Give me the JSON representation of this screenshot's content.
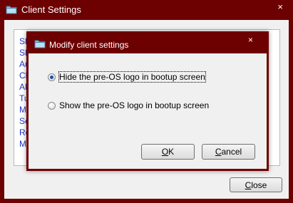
{
  "outer_window": {
    "title": "Client Settings",
    "close_glyph": "×",
    "icon": "folder-icon",
    "list_items": [
      "Sh",
      "Sh",
      "Au",
      "Ch",
      "All",
      "Tu",
      "Mo",
      "Se",
      "Re",
      "Ma"
    ],
    "close_button": {
      "accel": "C",
      "rest": "lose"
    }
  },
  "dialog": {
    "title": "Modify client settings",
    "close_glyph": "×",
    "icon": "folder-icon",
    "options": [
      {
        "label": "Hide the pre-OS logo in bootup screen",
        "selected": true
      },
      {
        "label": "Show the pre-OS logo in bootup screen",
        "selected": false
      }
    ],
    "ok_button": {
      "accel": "O",
      "rest": "K"
    },
    "cancel_button": {
      "accel": "C",
      "rest": "ancel"
    }
  },
  "colors": {
    "titlebar": "#6d0000",
    "client": "#f0f0f0",
    "link": "#1a33cc"
  }
}
